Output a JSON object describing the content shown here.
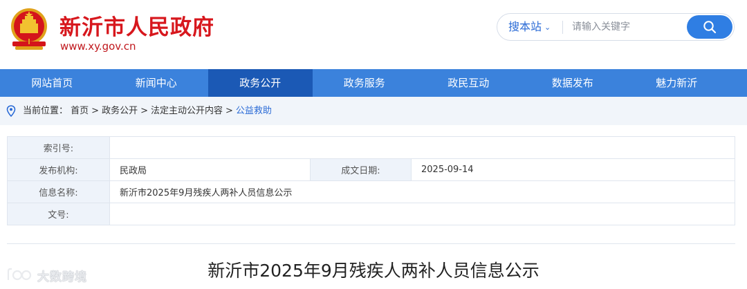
{
  "header": {
    "site_title": "新沂市人民政府",
    "site_url": "www.xy.gov.cn",
    "emblem": "national-emblem"
  },
  "search": {
    "scope_label": "搜本站",
    "placeholder": "请输入关键字",
    "button_icon": "search-icon"
  },
  "nav": {
    "items": [
      {
        "label": "网站首页"
      },
      {
        "label": "新闻中心"
      },
      {
        "label": "政务公开"
      },
      {
        "label": "政务服务"
      },
      {
        "label": "政民互动"
      },
      {
        "label": "数据发布"
      },
      {
        "label": "魅力新沂"
      }
    ],
    "active_index": 2
  },
  "breadcrumb": {
    "icon": "location-pin-icon",
    "prefix": "当前位置：",
    "items": [
      "首页",
      "政务公开",
      "法定主动公开内容",
      "公益救助"
    ],
    "separator": ">"
  },
  "info": {
    "index_label": "索引号:",
    "index_value": "",
    "publisher_label": "发布机构:",
    "publisher_value": "民政局",
    "date_label": "成文日期:",
    "date_value": "2025-09-14",
    "name_label": "信息名称:",
    "name_value": "新沂市2025年9月残疾人两补人员信息公示",
    "docno_label": "文号:",
    "docno_value": ""
  },
  "document": {
    "title": "新沂市2025年9月残疾人两补人员信息公示"
  },
  "watermark": {
    "text": "大数跨境"
  },
  "colors": {
    "brand_red": "#d7171d",
    "nav_blue": "#3b82dc",
    "nav_active": "#1b59b5",
    "link_blue": "#2b6bd6",
    "search_button": "#2f7ee3"
  }
}
